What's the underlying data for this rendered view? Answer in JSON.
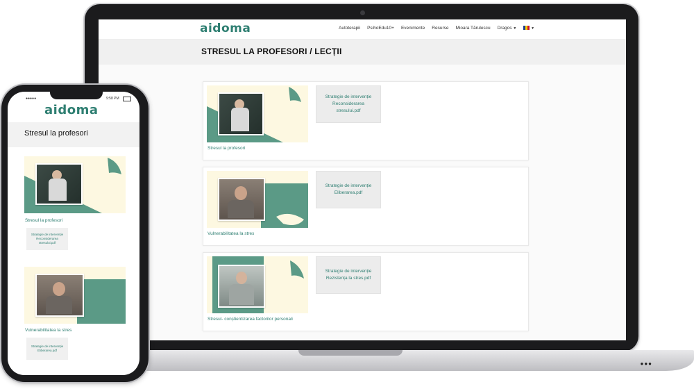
{
  "laptop": {
    "logo": "aidoma",
    "nav": {
      "items": [
        "Autoterapii",
        "PsihoEdu10+",
        "Evenimente",
        "Resurse",
        "Mioara Tărulescu"
      ],
      "user": "Dragos",
      "language_flag": "flag-ro-icon"
    },
    "page_title": "STRESUL LA PROFESORI / LECȚII",
    "cards": [
      {
        "label": "Stresul la profesori",
        "pdf_lines": [
          "Strategie de intervenție",
          "Reconsiderarea",
          "stresului.pdf"
        ]
      },
      {
        "label": "Vulnerabilitatea la stres",
        "pdf_lines": [
          "Strategie de intervenție",
          "Eliberarea.pdf"
        ]
      },
      {
        "label": "Stresul- conștientizarea factorilor personali",
        "pdf_lines": [
          "Strategie de intervenție",
          "Rezistența la stres.pdf"
        ]
      }
    ]
  },
  "phone": {
    "status_left": "●●●●●",
    "status_time": "9:58 PM",
    "logo": "aidoma",
    "page_title": "Stresul la profesori",
    "cards": [
      {
        "label": "Stresul la profesori",
        "pdf_lines": [
          "Strategie de intervenție",
          "Reconsiderarea",
          "stresului.pdf"
        ]
      },
      {
        "label": "Vulnerabilitatea la stres",
        "pdf_lines": [
          "Strategie de intervenție",
          "Eliberarea.pdf"
        ]
      }
    ]
  },
  "colors": {
    "accent": "#2f7f72",
    "thumb_bg": "#fdf8e1",
    "thumb_shape": "#5b9a86"
  }
}
